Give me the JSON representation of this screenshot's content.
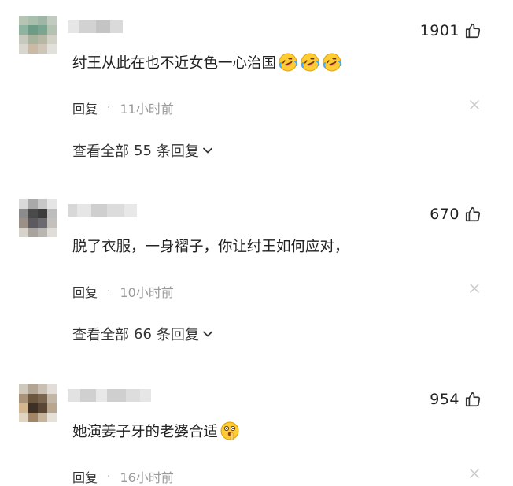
{
  "comments": [
    {
      "like_count": "1901",
      "content": "纣王从此在也不近女色一心治国",
      "emoji_count": 3,
      "emoji_icon": "rolling-laughing-emoji",
      "reply_label": "回复",
      "separator": "·",
      "time": "11小时前",
      "view_prefix": "查看全部",
      "reply_count": "55",
      "view_suffix": "条回复"
    },
    {
      "like_count": "670",
      "content": "脱了衣服，一身褶子，你让纣王如何应对，",
      "emoji_count": 0,
      "reply_label": "回复",
      "separator": "·",
      "time": "10小时前",
      "view_prefix": "查看全部",
      "reply_count": "66",
      "view_suffix": "条回复"
    },
    {
      "like_count": "954",
      "content": "她演姜子牙的老婆合适",
      "emoji_count": 1,
      "emoji_icon": "shushing-face-emoji",
      "reply_label": "回复",
      "separator": "·",
      "time": "16小时前"
    }
  ],
  "icons": {
    "like": "thumbs-up-icon",
    "close": "close-icon",
    "expand": "chevron-down-icon"
  },
  "colors": {
    "text": "#222222",
    "muted": "#9a9a9a",
    "icon": "#333333",
    "close": "#c8c8c8"
  }
}
